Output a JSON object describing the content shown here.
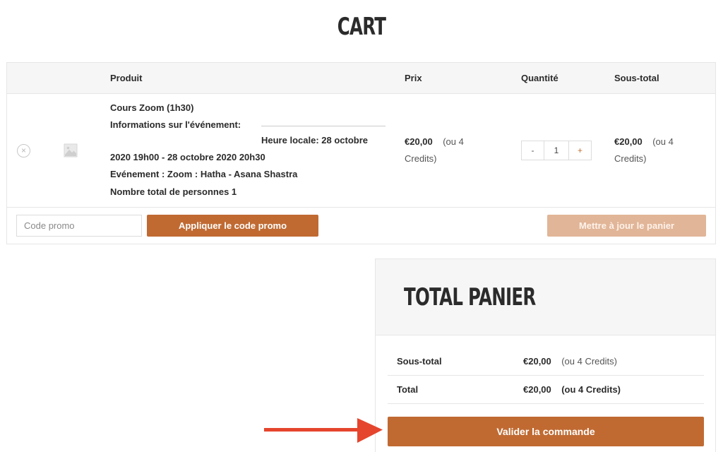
{
  "page": {
    "title": "CART"
  },
  "table": {
    "headers": {
      "product": "Produit",
      "price": "Prix",
      "quantity": "Quantité",
      "subtotal": "Sous-total"
    }
  },
  "item": {
    "remove_icon": "close-circle-icon",
    "thumbnail_icon": "image-placeholder-icon",
    "name": "Cours Zoom (1h30)",
    "event_label": "Informations sur l'événement:",
    "local_time_line1": "Heure locale: 28 octobre",
    "local_time_line2": "2020 19h00 - 28 octobre 2020 20h30",
    "event_name": "Evénement : Zoom : Hatha - Asana Shastra",
    "persons": "Nombre total de personnes 1",
    "price": "€20,00",
    "price_credits_1": "(ou 4",
    "price_credits_2": "Credits)",
    "quantity": {
      "minus": "-",
      "value": "1",
      "plus": "+"
    },
    "subtotal": "€20,00",
    "subtotal_credits_1": "(ou 4",
    "subtotal_credits_2": "Credits)"
  },
  "actions": {
    "coupon_placeholder": "Code promo",
    "apply_label": "Appliquer le code promo",
    "update_label": "Mettre à jour le panier"
  },
  "totals": {
    "title": "TOTAL PANIER",
    "subtotal_label": "Sous-total",
    "subtotal_value": "€20,00",
    "subtotal_credits": "(ou 4 Credits)",
    "total_label": "Total",
    "total_value": "€20,00",
    "total_credits": "(ou 4 Credits)",
    "checkout_label": "Valider la commande"
  },
  "colors": {
    "accent": "#c06a32",
    "accent_disabled": "#e1b597",
    "arrow": "#e5452d"
  }
}
